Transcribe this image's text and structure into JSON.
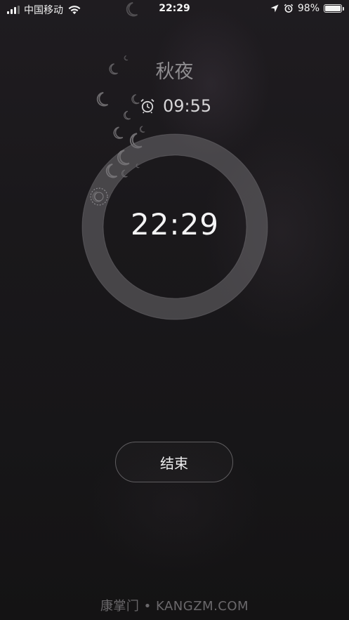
{
  "status_bar": {
    "carrier": "中国移动",
    "time": "22:29",
    "battery_percent": "98%",
    "battery_level": 0.98,
    "icons": [
      "signal-icon",
      "wifi-icon",
      "moon-icon",
      "location-icon",
      "alarm-icon",
      "battery-icon"
    ]
  },
  "sleep": {
    "title": "秋夜",
    "alarm_time": "09:55",
    "current_time": "22:29",
    "progress": 0.0
  },
  "actions": {
    "end_label": "结束"
  },
  "watermark": "康掌门 • KANGZM.COM",
  "colors": {
    "background": "#1a181b",
    "ring": "#7a787c",
    "title": "#8f8d90",
    "text": "#f4f4f5"
  }
}
